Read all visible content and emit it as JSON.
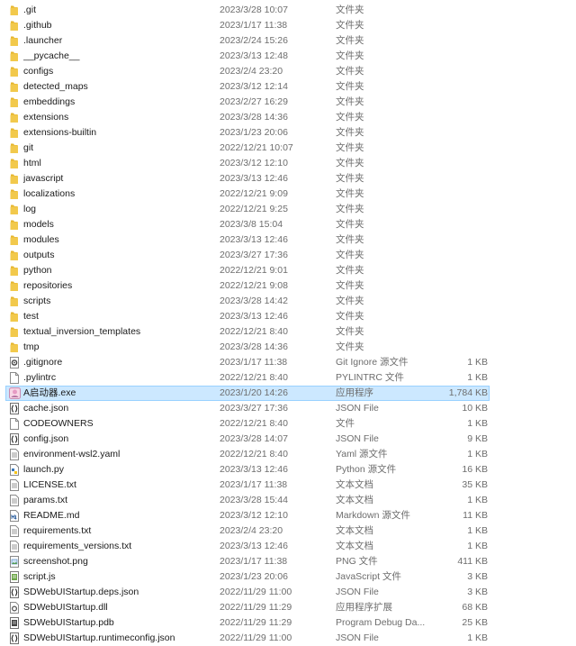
{
  "colors": {
    "folder": "#f2c94c",
    "folder_shade": "#e5b52e",
    "selected_bg": "#cce8ff",
    "selected_border": "#99d1ff",
    "meta_text": "#6d6d6d"
  },
  "files": [
    {
      "name": ".git",
      "date": "2023/3/28 10:07",
      "type": "文件夹",
      "size": "",
      "icon": "folder-icon"
    },
    {
      "name": ".github",
      "date": "2023/1/17 11:38",
      "type": "文件夹",
      "size": "",
      "icon": "folder-icon"
    },
    {
      "name": ".launcher",
      "date": "2023/2/24 15:26",
      "type": "文件夹",
      "size": "",
      "icon": "folder-icon"
    },
    {
      "name": "__pycache__",
      "date": "2023/3/13 12:48",
      "type": "文件夹",
      "size": "",
      "icon": "folder-icon"
    },
    {
      "name": "configs",
      "date": "2023/2/4 23:20",
      "type": "文件夹",
      "size": "",
      "icon": "folder-icon"
    },
    {
      "name": "detected_maps",
      "date": "2023/3/12 12:14",
      "type": "文件夹",
      "size": "",
      "icon": "folder-icon"
    },
    {
      "name": "embeddings",
      "date": "2023/2/27 16:29",
      "type": "文件夹",
      "size": "",
      "icon": "folder-icon"
    },
    {
      "name": "extensions",
      "date": "2023/3/28 14:36",
      "type": "文件夹",
      "size": "",
      "icon": "folder-icon"
    },
    {
      "name": "extensions-builtin",
      "date": "2023/1/23 20:06",
      "type": "文件夹",
      "size": "",
      "icon": "folder-icon"
    },
    {
      "name": "git",
      "date": "2022/12/21 10:07",
      "type": "文件夹",
      "size": "",
      "icon": "folder-icon"
    },
    {
      "name": "html",
      "date": "2023/3/12 12:10",
      "type": "文件夹",
      "size": "",
      "icon": "folder-icon"
    },
    {
      "name": "javascript",
      "date": "2023/3/13 12:46",
      "type": "文件夹",
      "size": "",
      "icon": "folder-icon"
    },
    {
      "name": "localizations",
      "date": "2022/12/21 9:09",
      "type": "文件夹",
      "size": "",
      "icon": "folder-icon"
    },
    {
      "name": "log",
      "date": "2022/12/21 9:25",
      "type": "文件夹",
      "size": "",
      "icon": "folder-icon"
    },
    {
      "name": "models",
      "date": "2023/3/8 15:04",
      "type": "文件夹",
      "size": "",
      "icon": "folder-icon"
    },
    {
      "name": "modules",
      "date": "2023/3/13 12:46",
      "type": "文件夹",
      "size": "",
      "icon": "folder-icon"
    },
    {
      "name": "outputs",
      "date": "2023/3/27 17:36",
      "type": "文件夹",
      "size": "",
      "icon": "folder-icon"
    },
    {
      "name": "python",
      "date": "2022/12/21 9:01",
      "type": "文件夹",
      "size": "",
      "icon": "folder-icon"
    },
    {
      "name": "repositories",
      "date": "2022/12/21 9:08",
      "type": "文件夹",
      "size": "",
      "icon": "folder-icon"
    },
    {
      "name": "scripts",
      "date": "2023/3/28 14:42",
      "type": "文件夹",
      "size": "",
      "icon": "folder-icon"
    },
    {
      "name": "test",
      "date": "2023/3/13 12:46",
      "type": "文件夹",
      "size": "",
      "icon": "folder-icon"
    },
    {
      "name": "textual_inversion_templates",
      "date": "2022/12/21 8:40",
      "type": "文件夹",
      "size": "",
      "icon": "folder-icon"
    },
    {
      "name": "tmp",
      "date": "2023/3/28 14:36",
      "type": "文件夹",
      "size": "",
      "icon": "folder-icon"
    },
    {
      "name": ".gitignore",
      "date": "2023/1/17 11:38",
      "type": "Git Ignore 源文件",
      "size": "1 KB",
      "icon": "gear-file-icon"
    },
    {
      "name": ".pylintrc",
      "date": "2022/12/21 8:40",
      "type": "PYLINTRC 文件",
      "size": "1 KB",
      "icon": "blank-file-icon"
    },
    {
      "name": "A启动器.exe",
      "date": "2023/1/20 14:26",
      "type": "应用程序",
      "size": "1,784 KB",
      "icon": "app-exe-icon",
      "selected": true
    },
    {
      "name": "cache.json",
      "date": "2023/3/27 17:36",
      "type": "JSON File",
      "size": "10 KB",
      "icon": "json-file-icon"
    },
    {
      "name": "CODEOWNERS",
      "date": "2022/12/21 8:40",
      "type": "文件",
      "size": "1 KB",
      "icon": "blank-file-icon"
    },
    {
      "name": "config.json",
      "date": "2023/3/28 14:07",
      "type": "JSON File",
      "size": "9 KB",
      "icon": "json-file-icon"
    },
    {
      "name": "environment-wsl2.yaml",
      "date": "2022/12/21 8:40",
      "type": "Yaml 源文件",
      "size": "1 KB",
      "icon": "text-file-icon"
    },
    {
      "name": "launch.py",
      "date": "2023/3/13 12:46",
      "type": "Python 源文件",
      "size": "16 KB",
      "icon": "python-file-icon"
    },
    {
      "name": "LICENSE.txt",
      "date": "2023/1/17 11:38",
      "type": "文本文档",
      "size": "35 KB",
      "icon": "text-file-icon"
    },
    {
      "name": "params.txt",
      "date": "2023/3/28 15:44",
      "type": "文本文档",
      "size": "1 KB",
      "icon": "text-file-icon"
    },
    {
      "name": "README.md",
      "date": "2023/3/12 12:10",
      "type": "Markdown 源文件",
      "size": "11 KB",
      "icon": "markdown-file-icon"
    },
    {
      "name": "requirements.txt",
      "date": "2023/2/4 23:20",
      "type": "文本文档",
      "size": "1 KB",
      "icon": "text-file-icon"
    },
    {
      "name": "requirements_versions.txt",
      "date": "2023/3/13 12:46",
      "type": "文本文档",
      "size": "1 KB",
      "icon": "text-file-icon"
    },
    {
      "name": "screenshot.png",
      "date": "2023/1/17 11:38",
      "type": "PNG 文件",
      "size": "411 KB",
      "icon": "image-file-icon"
    },
    {
      "name": "script.js",
      "date": "2023/1/23 20:06",
      "type": "JavaScript 文件",
      "size": "3 KB",
      "icon": "script-file-icon"
    },
    {
      "name": "SDWebUIStartup.deps.json",
      "date": "2022/11/29 11:00",
      "type": "JSON File",
      "size": "3 KB",
      "icon": "json-file-icon"
    },
    {
      "name": "SDWebUIStartup.dll",
      "date": "2022/11/29 11:29",
      "type": "应用程序扩展",
      "size": "68 KB",
      "icon": "dll-file-icon"
    },
    {
      "name": "SDWebUIStartup.pdb",
      "date": "2022/11/29 11:29",
      "type": "Program Debug Da...",
      "size": "25 KB",
      "icon": "pdb-file-icon"
    },
    {
      "name": "SDWebUIStartup.runtimeconfig.json",
      "date": "2022/11/29 11:00",
      "type": "JSON File",
      "size": "1 KB",
      "icon": "json-file-icon"
    }
  ]
}
